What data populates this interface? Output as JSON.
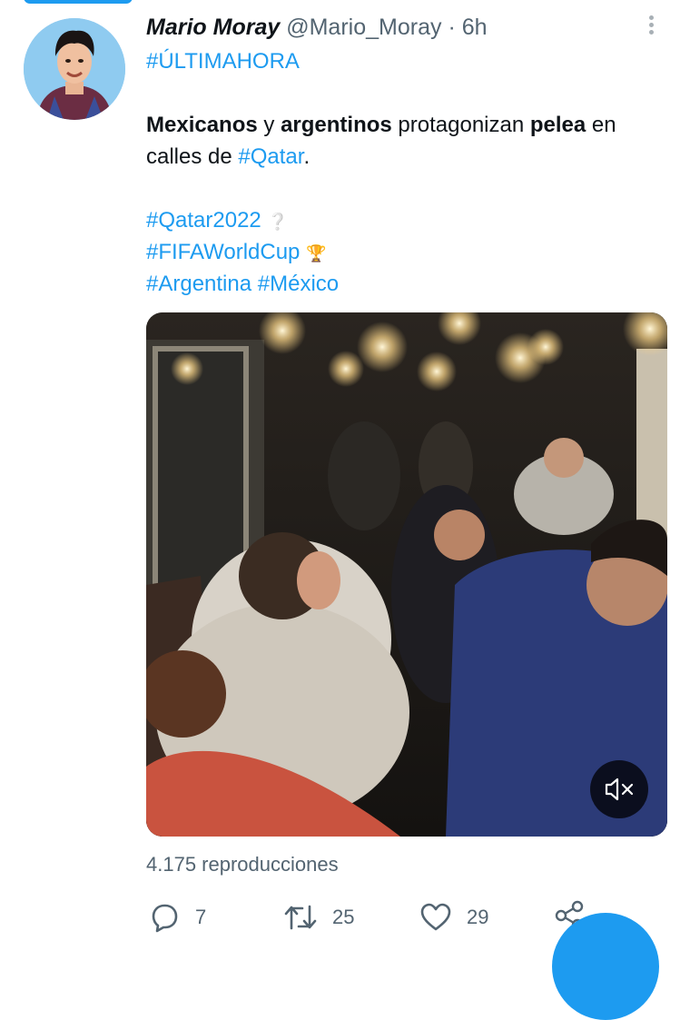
{
  "tweet": {
    "author_name": "Mario Moray",
    "handle": "@Mario_Moray",
    "separator": "·",
    "time_ago": "6h",
    "text": {
      "line1": "#ÚLTIMAHORA",
      "line3": [
        {
          "text": "Mexicanos",
          "style": "bold"
        },
        {
          "text": " y ",
          "style": "normal"
        },
        {
          "text": "argentinos",
          "style": "bold"
        },
        {
          "text": " protagonizan ",
          "style": "normal"
        },
        {
          "text": "pelea",
          "style": "bold"
        },
        {
          "text": " en",
          "style": "normal"
        }
      ],
      "line4_prefix": "calles de ",
      "line4_link": "#Qatar",
      "line4_suffix": ".",
      "hashtag1": "#Qatar2022",
      "hashtag1_emoji": "❔",
      "hashtag2": "#FIFAWorldCup",
      "hashtag2_emoji": "🏆",
      "hashtag3": "#Argentina",
      "hashtag4": "#México"
    },
    "views_text": "4.175 reproducciones",
    "actions": {
      "reply_count": "7",
      "retweet_count": "25",
      "like_count": "29"
    }
  },
  "colors": {
    "link": "#1d9bf0",
    "muted": "#536471",
    "text": "#0f1419"
  },
  "icons": {
    "more": "more-vertical-icon",
    "reply": "reply-icon",
    "retweet": "retweet-icon",
    "like": "heart-icon",
    "share": "share-icon",
    "mute": "speaker-muted-icon",
    "fab": "compose-fab"
  }
}
